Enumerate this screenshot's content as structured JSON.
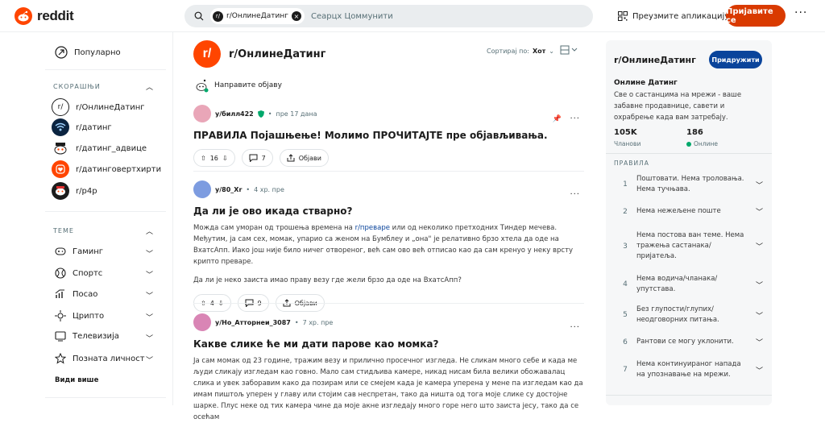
{
  "header": {
    "logo_text": "reddit",
    "search_chip": "r/ОнлинеДатинг",
    "search_placeholder": "Сеарцх Цоммунити",
    "get_app": "Преузмите апликацију",
    "login": "Пријавите се",
    "more": "···"
  },
  "left_nav": {
    "popular": "Популарно",
    "recent_header": "СКОРАШЊИ",
    "recent": [
      {
        "label": "r/ОнлинеДатинг",
        "color": "#ffffff"
      },
      {
        "label": "r/датинг",
        "color": "#0b2440"
      },
      {
        "label": "r/датинг_адвице",
        "color": "#ffffff"
      },
      {
        "label": "r/датинговертхирти",
        "color": "#ff4500"
      },
      {
        "label": "r/p4p",
        "color": "#1c1c1c"
      }
    ],
    "topics_header": "ТЕМЕ",
    "topics": [
      {
        "label": "Гаминг",
        "icon": "gamepad-icon"
      },
      {
        "label": "Спортс",
        "icon": "ball-icon"
      },
      {
        "label": "Посао",
        "icon": "chart-icon"
      },
      {
        "label": "Црипто",
        "icon": "crypto-icon"
      },
      {
        "label": "Телевизија",
        "icon": "tv-icon"
      },
      {
        "label": "Позната личност",
        "icon": "star-icon"
      }
    ],
    "see_more": "Види више"
  },
  "subreddit": {
    "logo_letter": "r/",
    "name": "r/ОнлинеДатинг",
    "sort_label": "Сортирај по:",
    "sort_value": "Хот",
    "create_post": "Направите објаву"
  },
  "posts": [
    {
      "user": "у/билл422",
      "time": "пре 17 дана",
      "title": "ПРАВИЛА Појашњење! Молимо ПРОЧИТАЈТЕ пре објављивања.",
      "body": "",
      "votes": "16",
      "comments": "7",
      "share": "Објави",
      "avatar_color": "#e9a6b8"
    },
    {
      "user": "у/80_Xr",
      "time": "4 хр. пре",
      "title": "Да ли је ово икада стварно?",
      "body_pre": "Можда сам уморан од трошења времена на ",
      "body_link": "r/преваре",
      "body_post": " или од неколико претходних Тиндер мечева. Међутим, ја сам сех, момак, упарио са женом на Бумблеу и „она\" је релативно брзо хтела да оде на ВхатсАпп. Иако још није било ничег отвореног, већ сам ово већ отписао као да сам кренуо у неку врсту крипто преваре.",
      "body2": "Да ли је неко заиста имао праву везу где жели брзо да оде на ВхатсАпп?",
      "votes": "4",
      "comments": "9",
      "share": "Објави",
      "avatar_color": "#7d9ce0"
    },
    {
      "user": "у/Но_Атторнеи_3087",
      "time": "7 хр. пре",
      "title": "Какве слике ће ми дати парове као момка?",
      "body": "Ја сам момак од 23 године, тражим везу и прилично просечног изгледа. Не сликам много себе и када ме људи сликају изгледам као говно. Мало сам стидљива камере, никад нисам била велики обожавалац слика и увек заборавим како да позирам или се смејем када је камера уперена у мене па изгледам као да имам пиштољ уперен у главу или стојим сав неспретан, тако да ништа од тога моје слике су достојне шарке. Плус неке од тих камера чине да моје акне изгледају много горе него што заиста јесу, тако да се осећам",
      "avatar_color": "#d985b5"
    }
  ],
  "sidebar": {
    "name": "r/ОнлинеДатинг",
    "join": "Придружити",
    "title": "Онлине Датинг",
    "description": "Све о састанцима на мрежи - ваше забавне продавнице, савети и охрабрење када вам затребају.",
    "members": "105K",
    "members_label": "Чланови",
    "online": "186",
    "online_label": "Онлине",
    "rules_header": "ПРАВИЛА",
    "rules": [
      {
        "n": "1",
        "text": "Поштовати. Нема троловања. Нема тучњава."
      },
      {
        "n": "2",
        "text": "Нема нежељене поште"
      },
      {
        "n": "3",
        "text": "Нема постова ван теме. Нема тражења састанака/ пријатеља."
      },
      {
        "n": "4",
        "text": "Нема водича/чланака/ упутстава."
      },
      {
        "n": "5",
        "text": "Без глупости/глупих/ неодговорних питања."
      },
      {
        "n": "6",
        "text": "Рантови се могу уклонити."
      },
      {
        "n": "7",
        "text": "Нема континуираног напада на упознавање на мрежи."
      }
    ]
  }
}
